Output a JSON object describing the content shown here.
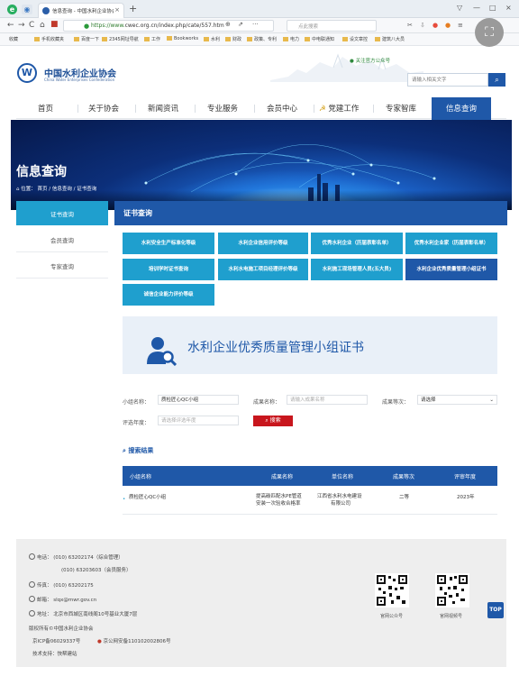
{
  "browser": {
    "tab_title": "信息查询 - 中国水利企业协会",
    "url_prefix": "https://www.",
    "url_rest": "cwec.org.cn/index.php/cate/557.htm",
    "search_placeholder": "点此搜索",
    "bookmarks": [
      "收藏",
      "手机收藏夹",
      "百度一下",
      "2345网址导航",
      "工作",
      "Bookworks",
      "水利",
      "财政",
      "政策、专利",
      "电力",
      "中电联通知",
      "设文章控",
      "建筑八大员"
    ]
  },
  "site": {
    "logo_cn": "中国水利企业协会",
    "logo_en": "China Water Enterprises Confederation",
    "wechat": "关注官方公众号",
    "search_placeholder": "请输入相关文字",
    "nav": [
      "首页",
      "关于协会",
      "新闻资讯",
      "专业服务",
      "会员中心",
      "党建工作",
      "专家智库",
      "信息查询"
    ]
  },
  "banner": {
    "title": "信息查询",
    "crumb_prefix": "位置：",
    "crumb_home": "首页",
    "crumb_sep1": "/",
    "crumb_mid": "信息查询",
    "crumb_sep2": "/",
    "crumb_last": "证书查询"
  },
  "sidebar": {
    "items": [
      "证书查询",
      "会员查询",
      "专家查询"
    ]
  },
  "content": {
    "heading": "证书查询",
    "cert_buttons": [
      "水利安全生产标准化等级",
      "水利企业信用评价等级",
      "优秀水利企业（历届表彰名单）",
      "优秀水利企业家（历届表彰名单）",
      "培训学时证书查询",
      "水利水电施工项目经理评价等级",
      "水利施工现场管理人员(五大员)",
      "水利企业优秀质量管理小组证书",
      "诚信企业能力评价等级"
    ],
    "hero_title": "水利企业优秀质量管理小组证书",
    "form": {
      "group_label": "小组名称：",
      "group_value": "质检匠心QC小组",
      "result_label": "成果名称：",
      "result_placeholder": "请输入成果名称",
      "grade_label": "成果等次：",
      "grade_value": "请选择",
      "year_label": "评选年度：",
      "year_placeholder": "请选择评选年度",
      "search_label": "搜索"
    },
    "results_title": "搜索结果",
    "table": {
      "headers": [
        "小组名称",
        "成果名称",
        "单位名称",
        "成果等次",
        "评审年度"
      ],
      "rows": [
        {
          "group": "质检匠心QC小组",
          "result_l1": "提高碳匹配水PE管道",
          "result_l2": "安装一次验收合格率",
          "unit_l1": "江西省水利水电建设",
          "unit_l2": "有限公司",
          "grade": "二等",
          "year": "2023年"
        }
      ]
    }
  },
  "footer": {
    "phone_label": "电话：",
    "phone1": "(010)  63202174（综合管理）",
    "phone2": "(010)  63203603（会员服务）",
    "fax": "传真：  (010)  63202175",
    "email": "邮箱：  slqx@mwr.gov.cn",
    "address": "地址：  北京市西城区南线阁10号基业大厦7层",
    "copyright": "版权所有©中国水利企业协会",
    "icp": "京ICP备06029337号",
    "police": "京公网安备110102002806号",
    "tech": "技术支持：快帮建站",
    "qr1_label": "官网公众号",
    "qr2_label": "官网视频号",
    "top_label": "TOP"
  },
  "colors": {
    "brand_blue": "#1f58a8",
    "light_blue": "#1f9fce",
    "red": "#c8161d"
  }
}
